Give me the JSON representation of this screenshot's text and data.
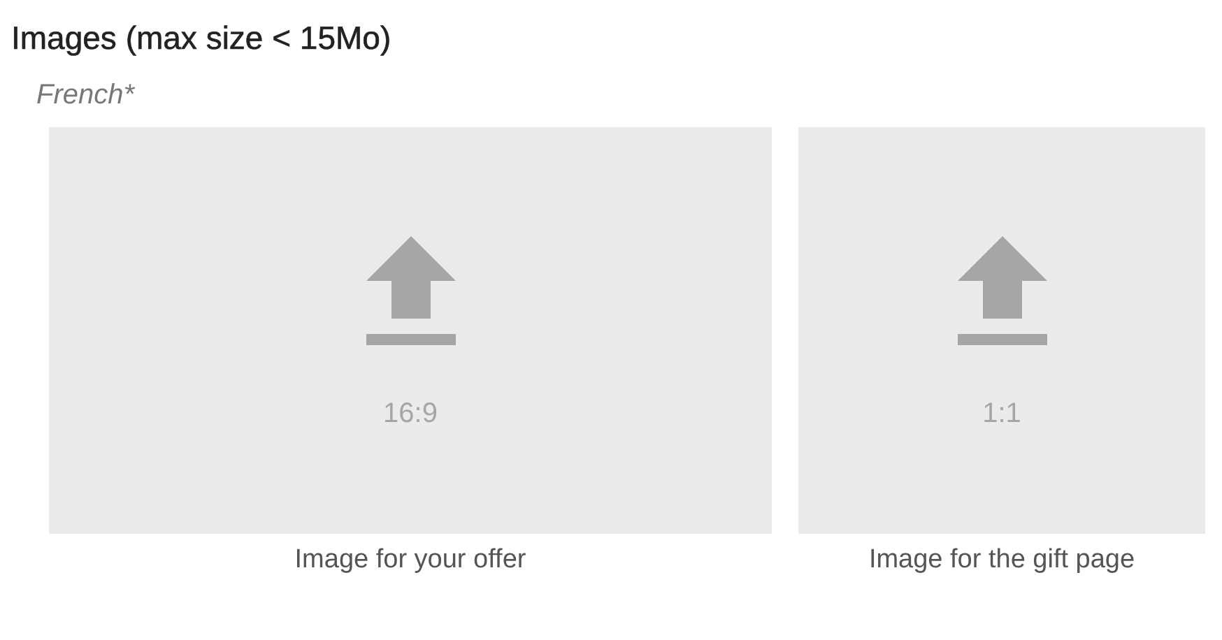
{
  "title": "Images (max size < 15Mo)",
  "language_label": "French*",
  "uploads": [
    {
      "ratio": "16:9",
      "caption": "Image for your offer",
      "kind": "wide"
    },
    {
      "ratio": "1:1",
      "caption": "Image for the gift page",
      "kind": "square"
    }
  ]
}
